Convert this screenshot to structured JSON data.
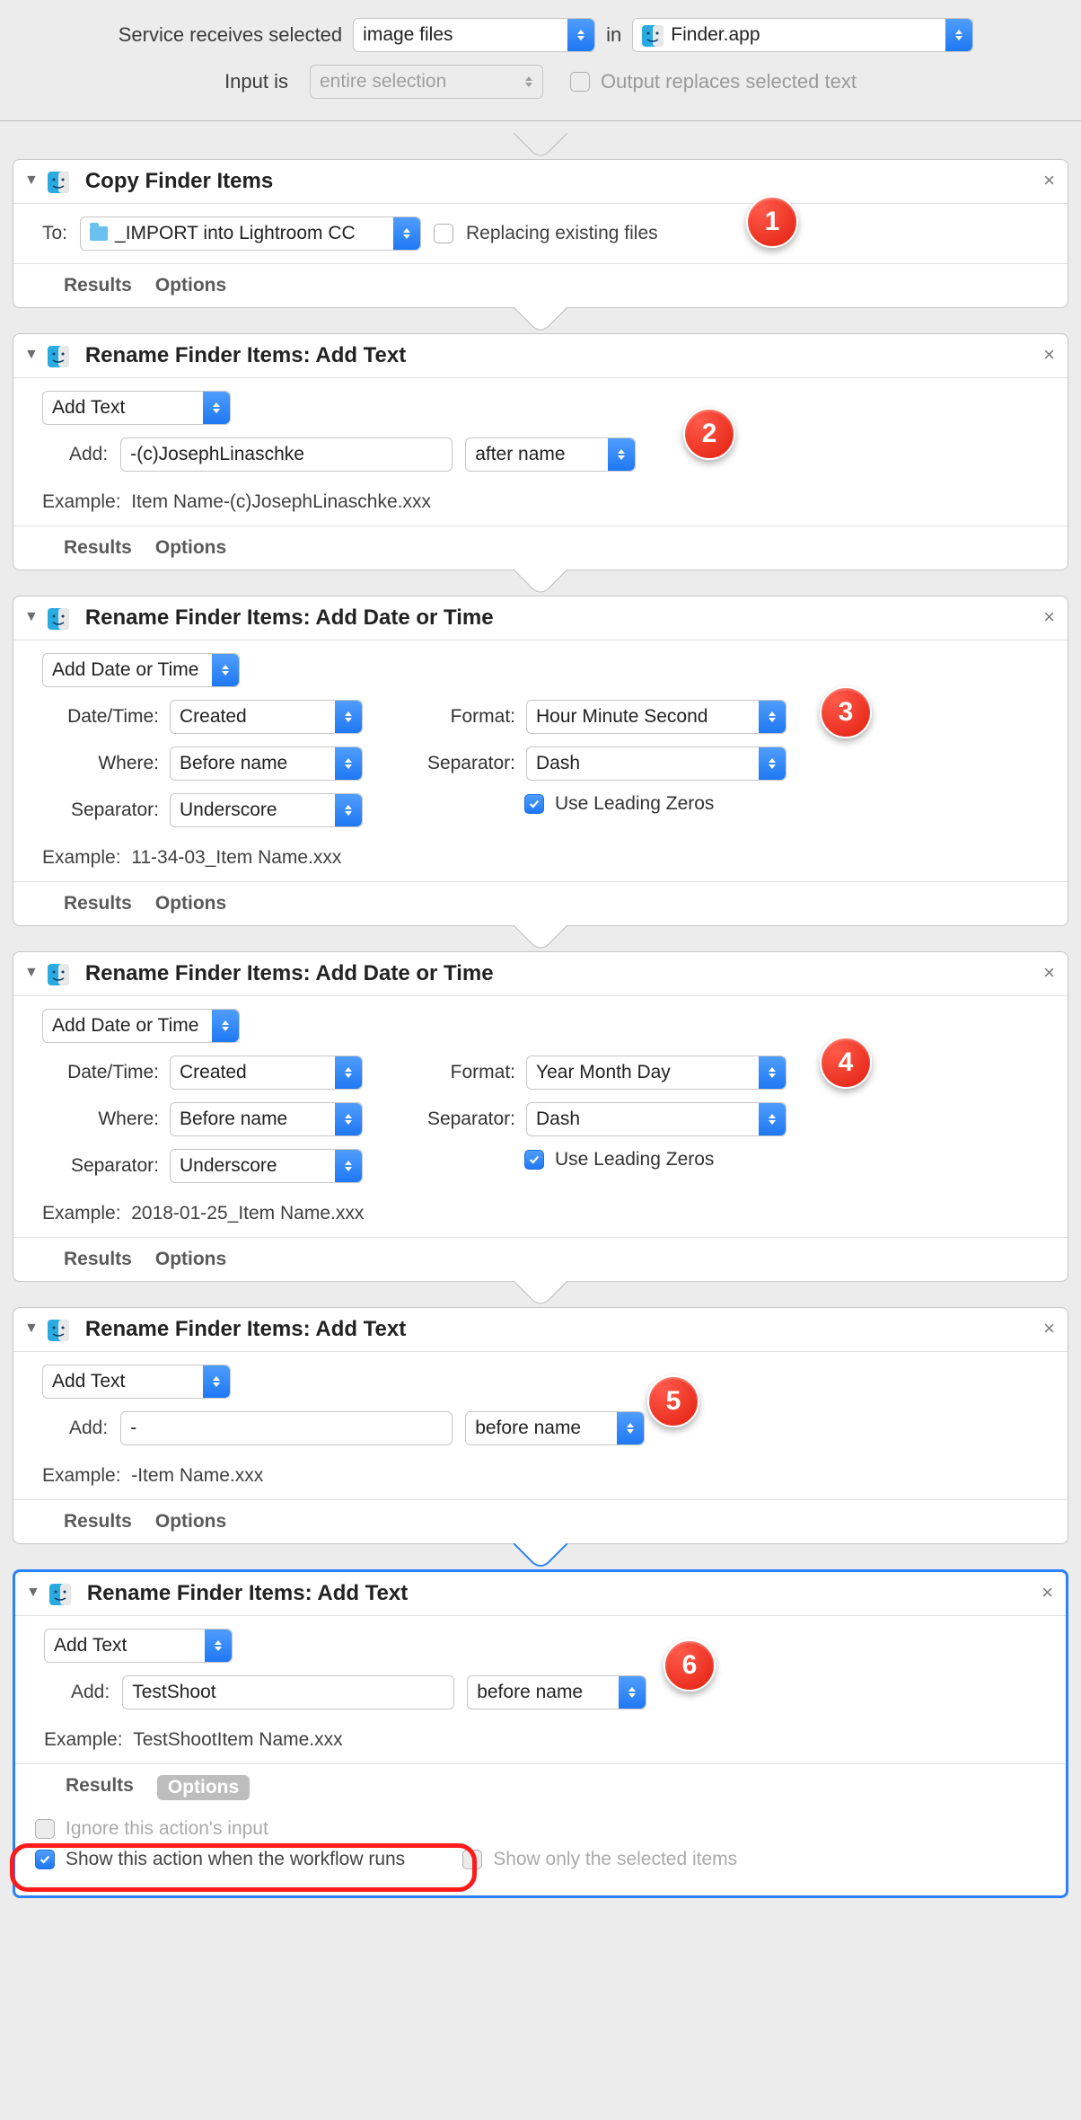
{
  "header": {
    "service_receives": "Service receives selected",
    "type": "image files",
    "in": "in",
    "app": "Finder.app",
    "input_is": "Input is",
    "input_scope": "entire selection",
    "output_replaces": "Output replaces selected text"
  },
  "common": {
    "results": "Results",
    "options": "Options",
    "example_label": "Example:"
  },
  "a1": {
    "title": "Copy Finder Items",
    "to": "To:",
    "folder": "_IMPORT into Lightroom CC",
    "replacing": "Replacing existing files",
    "badge": "1"
  },
  "a2": {
    "title": "Rename Finder Items: Add Text",
    "mode": "Add Text",
    "add": "Add:",
    "value": "-(c)JosephLinaschke",
    "position": "after name",
    "example": "Item Name-(c)JosephLinaschke.xxx",
    "badge": "2"
  },
  "a3": {
    "title": "Rename Finder Items: Add Date or Time",
    "mode": "Add Date or Time",
    "datetime_l": "Date/Time:",
    "datetime": "Created",
    "where_l": "Where:",
    "where": "Before name",
    "sep_l": "Separator:",
    "sep": "Underscore",
    "format_l": "Format:",
    "format": "Hour Minute Second",
    "sep2_l": "Separator:",
    "sep2": "Dash",
    "zeros": "Use Leading Zeros",
    "example": "11-34-03_Item Name.xxx",
    "badge": "3"
  },
  "a4": {
    "title": "Rename Finder Items: Add Date or Time",
    "mode": "Add Date or Time",
    "datetime_l": "Date/Time:",
    "datetime": "Created",
    "where_l": "Where:",
    "where": "Before name",
    "sep_l": "Separator:",
    "sep": "Underscore",
    "format_l": "Format:",
    "format": "Year Month Day",
    "sep2_l": "Separator:",
    "sep2": "Dash",
    "zeros": "Use Leading Zeros",
    "example": "2018-01-25_Item Name.xxx",
    "badge": "4"
  },
  "a5": {
    "title": "Rename Finder Items: Add Text",
    "mode": "Add Text",
    "add": "Add:",
    "value": "-",
    "position": "before name",
    "example": "-Item Name.xxx",
    "badge": "5"
  },
  "a6": {
    "title": "Rename Finder Items: Add Text",
    "mode": "Add Text",
    "add": "Add:",
    "value": "TestShoot",
    "position": "before name",
    "example": "TestShootItem Name.xxx",
    "badge": "6",
    "ignore": "Ignore this action's input",
    "show_running": "Show this action when the workflow runs",
    "show_selected": "Show only the selected items"
  }
}
